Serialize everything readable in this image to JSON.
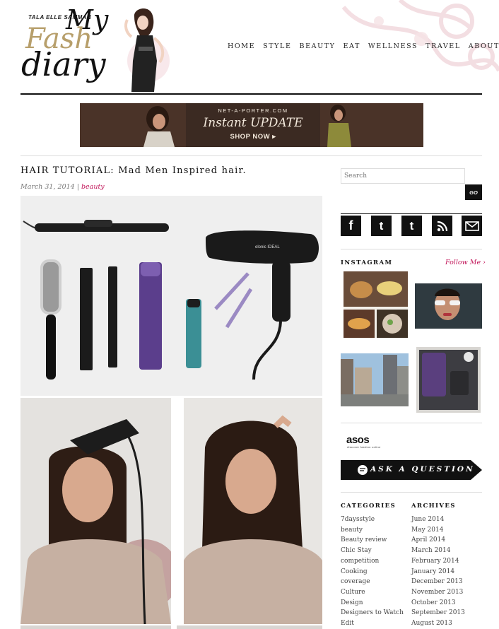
{
  "logo": {
    "tagline": "TALA ELLE SAMMAN",
    "line1": "My",
    "line2": "Fash",
    "line3": "diary"
  },
  "nav": {
    "items": [
      "HOME",
      "STYLE",
      "BEAUTY",
      "EAT",
      "WELLNESS",
      "TRAVEL",
      "ABOUT"
    ]
  },
  "banner": {
    "brand": "NET-A-PORTER.COM",
    "headline": "Instant UPDATE",
    "cta": "SHOP NOW ▸"
  },
  "post": {
    "title": "HAIR TUTORIAL: Mad Men Inspired hair.",
    "date": "March 31, 2014",
    "separator": " | ",
    "category": "beauty",
    "dryer_brand": "elonic  IDEAL"
  },
  "sidebar": {
    "search_placeholder": "Search",
    "go_label": "GO",
    "social": [
      {
        "icon": "facebook-icon",
        "glyph": "f"
      },
      {
        "icon": "twitter-icon",
        "glyph": "t"
      },
      {
        "icon": "tumblr-icon",
        "glyph": "t"
      },
      {
        "icon": "rss-icon",
        "glyph": "rss"
      },
      {
        "icon": "mail-icon",
        "glyph": "mail"
      }
    ],
    "instagram_title": "INSTAGRAM",
    "instagram_follow": "Follow Me ›",
    "asos_logo": "asos",
    "asos_sub": "discover fashion online",
    "ask_label": "ASK A QUESTION",
    "categories_title": "CATEGORIES",
    "categories": [
      "7daysstyle",
      "beauty",
      "Beauty review",
      "Chic Stay",
      "competition",
      "Cooking",
      "coverage",
      "Culture",
      "Design",
      "Designers to Watch",
      "Edit"
    ],
    "archives_title": "ARCHIVES",
    "archives": [
      "June 2014",
      "May 2014",
      "April 2014",
      "March 2014",
      "February 2014",
      "January 2014",
      "December 2013",
      "November 2013",
      "October 2013",
      "September 2013",
      "August 2013"
    ]
  },
  "colors": {
    "accent": "#c2185b",
    "gold": "#b79f6b",
    "black": "#111111"
  }
}
